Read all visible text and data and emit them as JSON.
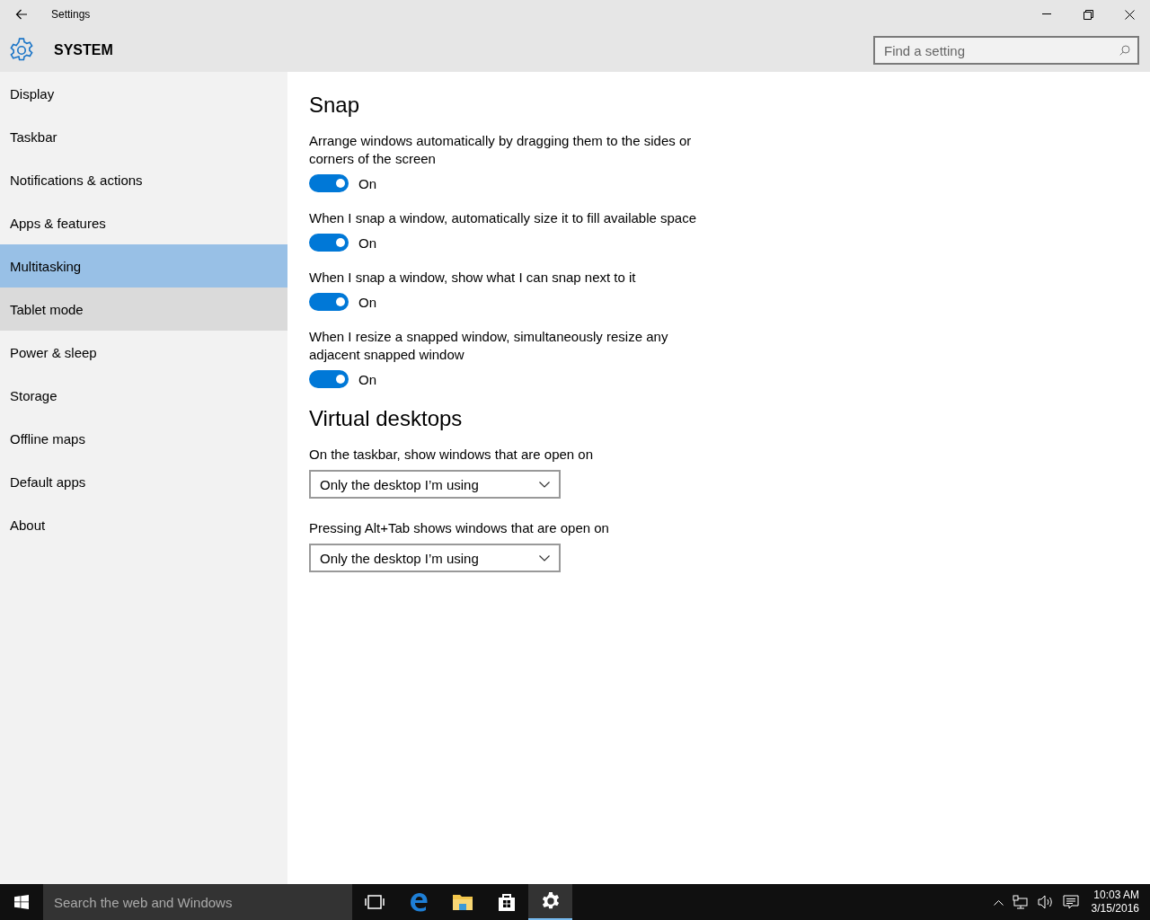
{
  "window": {
    "title": "Settings"
  },
  "header": {
    "title": "SYSTEM"
  },
  "search": {
    "placeholder": "Find a setting"
  },
  "sidebar": {
    "items": [
      {
        "label": "Display",
        "selected": false,
        "hovered": false
      },
      {
        "label": "Taskbar",
        "selected": false,
        "hovered": false
      },
      {
        "label": "Notifications & actions",
        "selected": false,
        "hovered": false
      },
      {
        "label": "Apps & features",
        "selected": false,
        "hovered": false
      },
      {
        "label": "Multitasking",
        "selected": true,
        "hovered": false
      },
      {
        "label": "Tablet mode",
        "selected": false,
        "hovered": true
      },
      {
        "label": "Power & sleep",
        "selected": false,
        "hovered": false
      },
      {
        "label": "Storage",
        "selected": false,
        "hovered": false
      },
      {
        "label": "Offline maps",
        "selected": false,
        "hovered": false
      },
      {
        "label": "Default apps",
        "selected": false,
        "hovered": false
      },
      {
        "label": "About",
        "selected": false,
        "hovered": false
      }
    ]
  },
  "sections": [
    {
      "heading": "Snap",
      "settings": [
        {
          "kind": "toggle",
          "description": "Arrange windows automatically by dragging them to the sides or corners of the screen",
          "on": true,
          "state_label": "On"
        },
        {
          "kind": "toggle",
          "description": "When I snap a window, automatically size it to fill available space",
          "on": true,
          "state_label": "On"
        },
        {
          "kind": "toggle",
          "description": "When I snap a window, show what I can snap next to it",
          "on": true,
          "state_label": "On"
        },
        {
          "kind": "toggle",
          "description": "When I resize a snapped window, simultaneously resize any adjacent snapped window",
          "on": true,
          "state_label": "On"
        }
      ]
    },
    {
      "heading": "Virtual desktops",
      "settings": [
        {
          "kind": "dropdown",
          "description": "On the taskbar, show windows that are open on",
          "value": "Only the desktop I’m using"
        },
        {
          "kind": "dropdown",
          "description": "Pressing Alt+Tab shows windows that are open on",
          "value": "Only the desktop I’m using"
        }
      ]
    }
  ],
  "taskbar": {
    "search_placeholder": "Search the web and Windows",
    "apps": [
      {
        "kind": "task-view",
        "active": false
      },
      {
        "kind": "edge",
        "active": false
      },
      {
        "kind": "explorer",
        "active": false
      },
      {
        "kind": "store",
        "active": false
      },
      {
        "kind": "settings",
        "active": true
      }
    ],
    "time": "10:03 AM",
    "date": "3/15/2016"
  }
}
